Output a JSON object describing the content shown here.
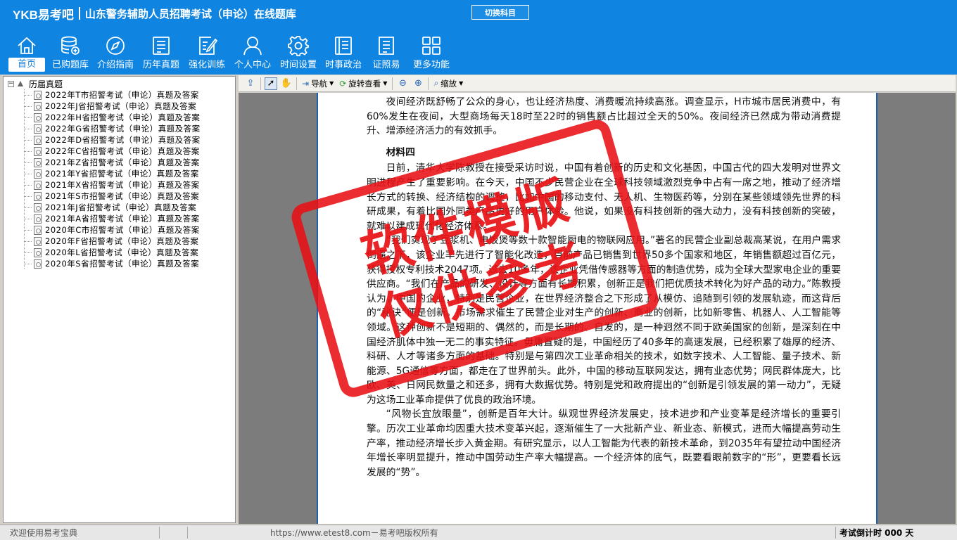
{
  "app": {
    "logo": "YKB易考吧",
    "title": "山东警务辅助人员招聘考试（申论）在线题库",
    "switch_button": "切换科目"
  },
  "nav": [
    {
      "label": "首页",
      "icon": "home-icon",
      "active": true
    },
    {
      "label": "已购题库",
      "icon": "database-icon"
    },
    {
      "label": "介绍指南",
      "icon": "compass-icon"
    },
    {
      "label": "历年真题",
      "icon": "list-icon"
    },
    {
      "label": "强化训练",
      "icon": "edit-icon"
    },
    {
      "label": "个人中心",
      "icon": "user-icon"
    },
    {
      "label": "时间设置",
      "icon": "gear-icon"
    },
    {
      "label": "时事政治",
      "icon": "book-icon"
    },
    {
      "label": "证照易",
      "icon": "document-icon"
    },
    {
      "label": "更多功能",
      "icon": "grid-icon"
    }
  ],
  "tree": {
    "root": "历届真题",
    "items": [
      "2022年T市招警考试（申论）真题及答案",
      "2022年J省招警考试（申论）真题及答案",
      "2022年H省招警考试（申论）真题及答案",
      "2022年G省招警考试（申论）真题及答案",
      "2022年D省招警考试（申论）真题及答案",
      "2022年C省招警考试（申论）真题及答案",
      "2021年Z省招警考试（申论）真题及答案",
      "2021年Y省招警考试（申论）真题及答案",
      "2021年X省招警考试（申论）真题及答案",
      "2021年S市招警考试（申论）真题及答案",
      "2021年J省招警考试（申论）真题及答案",
      "2021年A省招警考试（申论）真题及答案",
      "2020年C市招警考试（申论）真题及答案",
      "2020年F省招警考试（申论）真题及答案",
      "2020年L省招警考试（申论）真题及答案",
      "2020年S省招警考试（申论）真题及答案"
    ]
  },
  "toolbar": {
    "nav_label": "导航",
    "rotate_label": "旋转查看",
    "zoom_label": "缩放"
  },
  "document": {
    "para1": "夜间经济既舒畅了公众的身心，也让经济热度、消费暖流持续高涨。调查显示，H市城市居民消费中，有60%发生在夜间，大型商场每天18时至22时的销售额占比超过全天的50%。夜间经济已然成为带动消费提升、增添经济活力的有效抓手。",
    "heading": "材料四",
    "para2": "日前，清华大学陈教授在接受采访时说，中国有着创新的历史和文化基因，中国古代的四大发明对世界文明进程产生了重要影响。在今天，中国不少民营企业在全球科技领域激烈竞争中占有一席之地，推动了经济增长方式的转换、经济结构的调整，比如中国的移动支付、无人机、生物医药等，分别在某些领域领先世界的科研成果，有着比国外同类产品更好的用户体验。他说，如果没有科技创新的强大动力，没有科技创新的突破，就难以建成现代化经济体系。",
    "para3": "“我们实现了豆浆机、电饭煲等数十款智能厨电的物联网应用。”著名的民营企业副总裁高某说，在用户需求倒逼之下，该企业率先进行了智能化改造，目前产品已销售到世界50多个国家和地区，年销售额超过百亿元，获得授权专利技术2047项。过去10多年，该企业凭借传感器等方面的制造优势，成为全球大型家电企业的重要供应商。“我们在产品的研发、设计等方面有长期积累，创新正是我们把优质技术转化为好产品的动力。”陈教授认为，中国的企业，特别是民营企业，在世界经济整合之下形成了从模仿、追随到引领的发展轨迹，而这背后的“秘诀”便是创新。市场需求催生了民营企业对生产的创新、商业的创新，比如新零售、机器人、人工智能等领域。这种创新不是短期的、偶然的，而是长期的、自发的，是一种迥然不同于欧美国家的创新，是深刻在中国经济肌体中独一无二的事实特征。毋庸置疑的是，中国经历了40多年的高速发展，已经积累了雄厚的经济、科研、人才等诸多方面的基础。特别是与第四次工业革命相关的技术，如数字技术、人工智能、量子技术、新能源、5G通信等方面，都走在了世界前头。此外，中国的移动互联网发达，拥有业态优势；网民群体庞大，比欧、美、日网民数量之和还多，拥有大数据优势。特别是党和政府提出的“创新是引领发展的第一动力”，无疑为这场工业革命提供了优良的政治环境。",
    "para4": "“风物长宜放眼量”，创新是百年大计。纵观世界经济发展史，技术进步和产业变革是经济增长的重要引擎。历次工业革命均因重大技术变革兴起，逐渐催生了一大批新产业、新业态、新模式，进而大幅提高劳动生产率，推动经济增长步入黄金期。有研究显示，以人工智能为代表的新技术革命，到2035年有望拉动中国经济年增长率明显提升，推动中国劳动生产率大幅提高。一个经济体的底气，既要看眼前数字的“形”，更要看长远发展的“势”。"
  },
  "stamp": {
    "line1": "软件模版",
    "line2": "仅供参考"
  },
  "status": {
    "welcome": "欢迎使用易考宝典",
    "url": "https://www.etest8.com－易考吧版权所有",
    "countdown": "考试倒计时 000 天"
  },
  "colors": {
    "header_blue": "#0f84e0",
    "stamp_red": "#e81014",
    "page_border": "#1f5fb0"
  }
}
